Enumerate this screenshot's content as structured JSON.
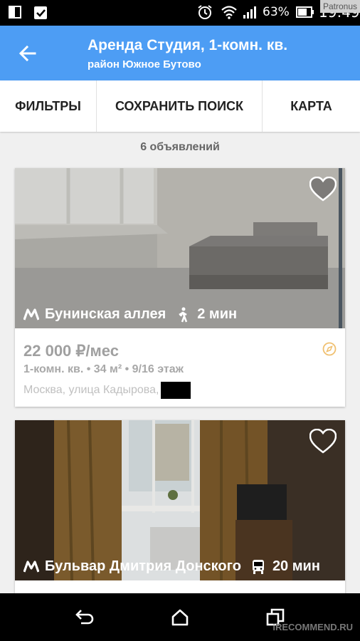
{
  "status_bar": {
    "battery_percent": "63%",
    "time": "19:49",
    "icons": [
      "screen-mirror-icon",
      "clipboard-check-icon",
      "alarm-icon",
      "wifi-icon",
      "signal-icon",
      "battery-icon"
    ]
  },
  "watermark_top": "Patronus",
  "app_bar": {
    "title": "Аренда Студия, 1-комн. кв.",
    "subtitle": "район Южное Бутово",
    "back_icon": "arrow-back-icon",
    "color": "#4d9df4"
  },
  "actions": {
    "filters": "ФИЛЬТРЫ",
    "save_search": "СОХРАНИТЬ ПОИСК",
    "map": "КАРТА"
  },
  "results_count": "6 объявлений",
  "listings": [
    {
      "metro_station": "Бунинская аллея",
      "travel_mode": "walk-icon",
      "travel_time": "2 мин",
      "price": "22 000 ₽/мес",
      "details": "1-комн. кв. • 34 м² • 9/16 этаж",
      "address": "Москва, улица Кадырова,",
      "favorite_icon": "heart-outline-icon",
      "status_icon": "compass-icon"
    },
    {
      "metro_station": "Бульвар Дмитрия Донского",
      "travel_mode": "bus-icon",
      "travel_time": "20 мин",
      "favorite_icon": "heart-outline-icon"
    }
  ],
  "nav_bar": {
    "icons": [
      "back-nav-icon",
      "home-nav-icon",
      "recents-nav-icon"
    ]
  },
  "watermark_bottom": "iRECOMMEND.RU"
}
